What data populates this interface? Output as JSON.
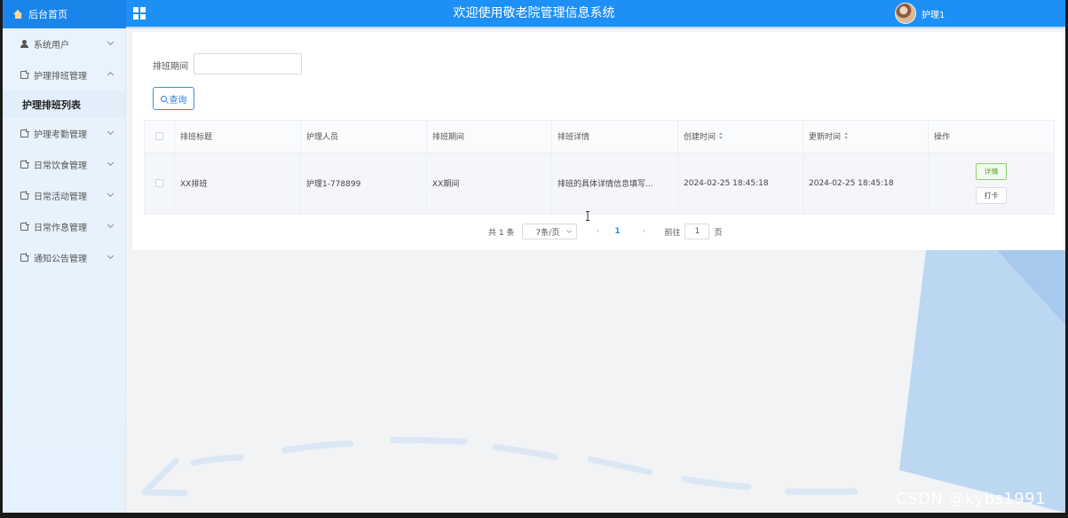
{
  "header": {
    "home_label": "后台首页",
    "title": "欢迎使用敬老院管理信息系统",
    "user_name": "护理1"
  },
  "sidebar": {
    "items": [
      {
        "label": "系统用户",
        "icon": "user-icon"
      },
      {
        "label": "护理排班管理",
        "icon": "folder-icon",
        "expanded": true
      },
      {
        "label": "护理考勤管理",
        "icon": "folder-icon"
      },
      {
        "label": "日常饮食管理",
        "icon": "folder-icon"
      },
      {
        "label": "日常活动管理",
        "icon": "folder-icon"
      },
      {
        "label": "日常作息管理",
        "icon": "folder-icon"
      },
      {
        "label": "通知公告管理",
        "icon": "folder-icon"
      }
    ],
    "active_sub": "护理排班列表"
  },
  "search": {
    "label": "排班期间",
    "value": "",
    "button": "查询"
  },
  "table": {
    "columns": [
      "排班标题",
      "护理人员",
      "排班期间",
      "排班详情",
      "创建时间",
      "更新时间",
      "操作"
    ],
    "rows": [
      {
        "title": "XX排班",
        "staff": "护理1-778899",
        "period": "XX期间",
        "detail": "排班的具体详情信息填写...",
        "created": "2024-02-25 18:45:18",
        "updated": "2024-02-25 18:45:18",
        "actions": [
          "详情",
          "打卡"
        ]
      }
    ]
  },
  "pagination": {
    "total": "共 1 条",
    "page_size": "7条/页",
    "current_page": "1",
    "goto_label": "前往",
    "goto_value": "1",
    "page_unit": "页"
  },
  "watermark": "CSDN @kybs1991",
  "colors": {
    "topbar": "#1e90f5",
    "sidebar": "#e8f3fd",
    "accent": "#2b7fd9",
    "detail_button": "#5aa534"
  }
}
